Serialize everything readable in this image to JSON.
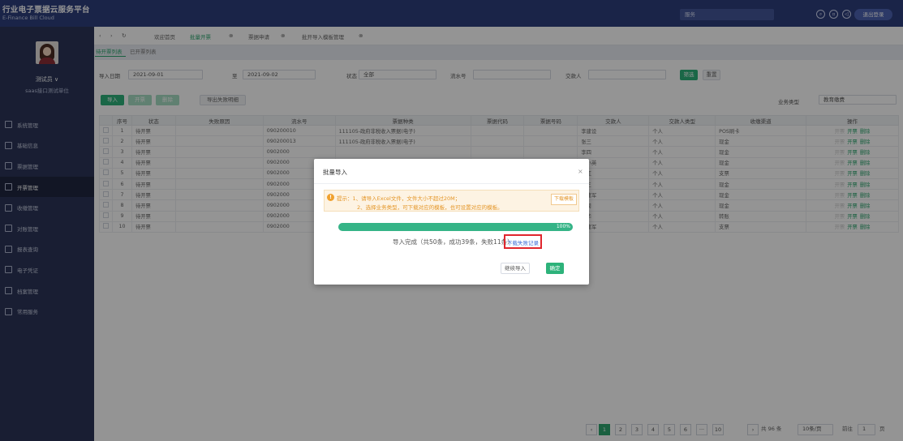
{
  "topbar": {
    "title": "行业电子票据云服务平台",
    "subtitle": "E-Finance Bill Cloud",
    "search_placeholder": "服务",
    "logout": "退出登录"
  },
  "sidebar": {
    "username": "测试员 ∨",
    "org": "saas接口测试单位",
    "items": [
      {
        "label": "系统管理"
      },
      {
        "label": "基础信息"
      },
      {
        "label": "票据管理"
      },
      {
        "label": "开票管理"
      },
      {
        "label": "收缴管理"
      },
      {
        "label": "对账管理"
      },
      {
        "label": "报表查询"
      },
      {
        "label": "电子凭证"
      },
      {
        "label": "档案管理"
      },
      {
        "label": "常用服务"
      }
    ]
  },
  "tabs": [
    {
      "label": "欢迎首页"
    },
    {
      "label": "批量开票"
    },
    {
      "label": "票据申请"
    },
    {
      "label": "批开导入模板管理"
    }
  ],
  "subtabs": [
    {
      "label": "待开票列表"
    },
    {
      "label": "已开票列表"
    }
  ],
  "filters": {
    "import_date_label": "导入日期",
    "date_from": "2021-09-01",
    "to_label": "至",
    "date_to": "2021-09-02",
    "status_label": "状态",
    "status_value": "全部",
    "serial_label": "流水号",
    "payer_label": "交款人",
    "search": "筛选",
    "reset": "重置"
  },
  "actions": {
    "import": "导入",
    "issue": "开票",
    "delete": "删除",
    "export_fail": "导出失败明细",
    "biz_type_label": "业务类型",
    "biz_type_value": "教育缴费"
  },
  "table": {
    "headers": [
      "",
      "序号",
      "状态",
      "失败原因",
      "流水号",
      "票据种类",
      "票据代码",
      "票据号码",
      "交款人",
      "交款人类型",
      "收缴渠道",
      "操作"
    ],
    "rows": [
      {
        "no": "1",
        "status": "待开票",
        "reason": "",
        "serial": "090200010",
        "kind": "111105-政府非税收入票据(电子)",
        "code": "",
        "number": "",
        "payer": "李建设",
        "ptype": "个人",
        "channel": "POS刷卡"
      },
      {
        "no": "2",
        "status": "待开票",
        "reason": "",
        "serial": "090200013",
        "kind": "111105-政府非税收入票据(电子)",
        "code": "",
        "number": "",
        "payer": "张三",
        "ptype": "个人",
        "channel": "现金"
      },
      {
        "no": "3",
        "status": "待开票",
        "reason": "",
        "serial": "0902000",
        "kind": "",
        "code": "",
        "number": "",
        "payer": "李四",
        "ptype": "个人",
        "channel": "现金"
      },
      {
        "no": "4",
        "status": "待开票",
        "reason": "",
        "serial": "0902000",
        "kind": "",
        "code": "",
        "number": "",
        "payer": "吴小英",
        "ptype": "个人",
        "channel": "现金"
      },
      {
        "no": "5",
        "status": "待开票",
        "reason": "",
        "serial": "0902000",
        "kind": "",
        "code": "",
        "number": "",
        "payer": "王红",
        "ptype": "个人",
        "channel": "支票"
      },
      {
        "no": "6",
        "status": "待开票",
        "reason": "",
        "serial": "0902000",
        "kind": "",
        "code": "",
        "number": "",
        "payer": "李三",
        "ptype": "个人",
        "channel": "现金"
      },
      {
        "no": "7",
        "status": "待开票",
        "reason": "",
        "serial": "0902000",
        "kind": "",
        "code": "",
        "number": "",
        "payer": "王建军",
        "ptype": "个人",
        "channel": "现金"
      },
      {
        "no": "8",
        "status": "待开票",
        "reason": "",
        "serial": "0902000",
        "kind": "",
        "code": "",
        "number": "",
        "payer": "李周",
        "ptype": "个人",
        "channel": "现金"
      },
      {
        "no": "9",
        "status": "待开票",
        "reason": "",
        "serial": "0902000",
        "kind": "",
        "code": "",
        "number": "",
        "payer": "吴华",
        "ptype": "个人",
        "channel": "转账"
      },
      {
        "no": "10",
        "status": "待开票",
        "reason": "",
        "serial": "0902000",
        "kind": "",
        "code": "",
        "number": "",
        "payer": "王建军",
        "ptype": "个人",
        "channel": "支票"
      }
    ],
    "op_view": "开票",
    "op_issue": "开票",
    "op_delete": "删除"
  },
  "pager": {
    "pages": [
      "1",
      "2",
      "3",
      "4",
      "5",
      "6",
      "···",
      "10"
    ],
    "total": "共 96 条",
    "per_page": "10条/页",
    "goto_label": "前往",
    "goto_value": "1",
    "page_suffix": "页"
  },
  "modal": {
    "title": "批量导入",
    "close": "×",
    "tip_line1": "提示：1、请导入Excel文件，文件大小不超过20M；",
    "tip_line2": "2、选择业务类型，可下载对应的模板，也可设置对应的模板。",
    "download_template": "下载模板",
    "progress_label": "100%",
    "progress_value": 1.0,
    "result": "导入完成（共50条，成功39条，失败11条）",
    "download_fail": "下载失败记录",
    "continue": "继续导入",
    "confirm": "确定"
  },
  "colors": {
    "brand": "#2e3f7c",
    "accent": "#2da66f",
    "highlight": "#e0262d",
    "warning": "#e49628"
  }
}
